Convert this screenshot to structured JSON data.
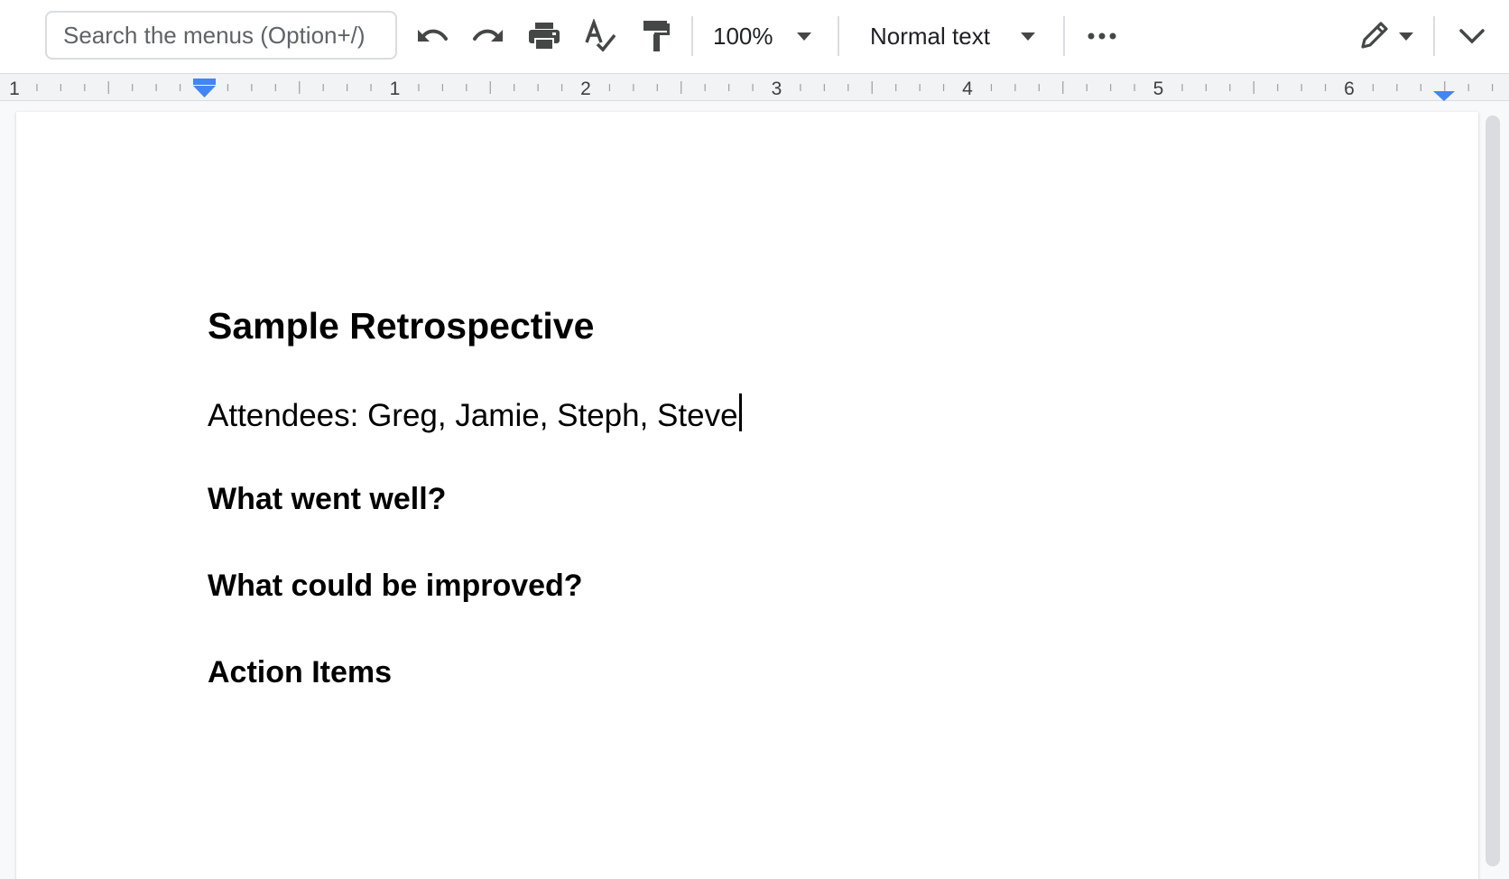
{
  "toolbar": {
    "search_placeholder": "Search the menus (Option+/)",
    "zoom_value": "100%",
    "style_value": "Normal text",
    "icons": [
      "undo-icon",
      "redo-icon",
      "print-icon",
      "spellcheck-icon",
      "paint-format-icon",
      "more-icon",
      "pencil-icon",
      "chevron-down-icon"
    ]
  },
  "ruler": {
    "labels": [
      "1",
      "1",
      "2",
      "3",
      "4",
      "5",
      "6"
    ]
  },
  "document": {
    "title": "Sample Retrospective",
    "attendees": "Attendees: Greg, Jamie, Steph, Steve",
    "headings": [
      "What went well?",
      "What could be improved?",
      "Action Items"
    ]
  },
  "colors": {
    "accent": "#4285f4",
    "divider": "#dadce0",
    "icon": "#444746"
  }
}
